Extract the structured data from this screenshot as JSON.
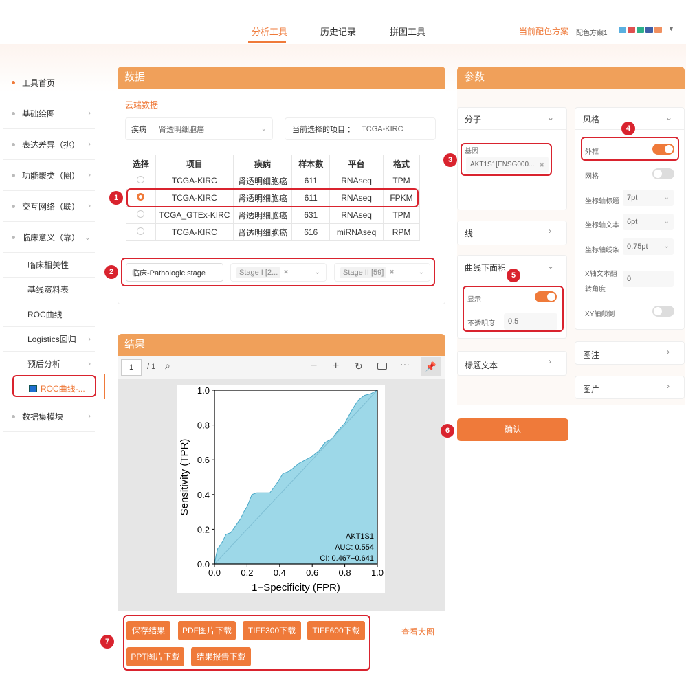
{
  "nav": {
    "tabs": [
      "分析工具",
      "历史记录",
      "拼图工具"
    ],
    "scheme_label": "当前配色方案",
    "scheme_value": "配色方案1",
    "swatch_colors": [
      "#5ab0e0",
      "#e05050",
      "#2db08a",
      "#3f5fa8",
      "#f09060"
    ]
  },
  "sidebar": {
    "items": [
      {
        "label": "工具首页"
      },
      {
        "label": "基础绘图"
      },
      {
        "label": "表达差异（挑）"
      },
      {
        "label": "功能聚类（圈）"
      },
      {
        "label": "交互网络（联）"
      },
      {
        "label": "临床意义（靠）"
      }
    ],
    "subitems": [
      {
        "label": "临床相关性"
      },
      {
        "label": "基线资料表"
      },
      {
        "label": "ROC曲线"
      },
      {
        "label": "Logistics回归"
      },
      {
        "label": "预后分析"
      }
    ],
    "active": "ROC曲线-...",
    "last": "数据集模块"
  },
  "data_panel": {
    "title": "数据",
    "cloud_link": "云端数据",
    "disease_label": "疾病",
    "disease_value": "肾透明细胞癌",
    "project_label": "当前选择的项目 ：",
    "project_value": "TCGA-KIRC",
    "table": {
      "headers": [
        "选择",
        "项目",
        "疾病",
        "样本数",
        "平台",
        "格式"
      ],
      "rows": [
        [
          "TCGA-KIRC",
          "肾透明细胞癌",
          "611",
          "RNAseq",
          "TPM"
        ],
        [
          "TCGA-KIRC",
          "肾透明细胞癌",
          "611",
          "RNAseq",
          "FPKM"
        ],
        [
          "TCGA_GTEx-KIRC",
          "肾透明细胞癌",
          "631",
          "RNAseq",
          "TPM"
        ],
        [
          "TCGA-KIRC",
          "肾透明细胞癌",
          "616",
          "miRNAseq",
          "RPM"
        ]
      ]
    },
    "filter_field": "临床-Pathologic.stage",
    "filter_g1": "Stage I [2...",
    "filter_g2": "Stage II [59]"
  },
  "result_panel": {
    "title": "结果",
    "page": "1",
    "page_total": "/ 1",
    "buttons": [
      "保存结果",
      "PDF图片下载",
      "TIFF300下载",
      "TIFF600下载",
      "PPT图片下载",
      "结果报告下载"
    ],
    "view_large": "查看大图"
  },
  "params": {
    "title": "参数",
    "molecule": "分子",
    "gene_label": "基因",
    "gene_value": "AKT1S1[ENSG000...",
    "line": "线",
    "auc_area": "曲线下面积",
    "show": "显示",
    "opacity_label": "不透明度",
    "opacity_value": "0.5",
    "title_text": "标题文本",
    "confirm": "确认",
    "style": "风格",
    "frame": "外框",
    "grid": "网格",
    "axis_title": "坐标轴标题",
    "axis_title_v": "7pt",
    "axis_text": "坐标轴文本",
    "axis_text_v": "6pt",
    "axis_line": "坐标轴线条",
    "axis_line_v": "0.75pt",
    "x_rot_1": "X轴文本翻",
    "x_rot_2": "转角度",
    "x_rot_v": "0",
    "xy_flip": "XY轴颠倒",
    "legend": "图注",
    "image": "图片"
  },
  "annotations": [
    "1",
    "2",
    "3",
    "4",
    "5",
    "6",
    "7"
  ],
  "chart_data": {
    "type": "area",
    "title": "",
    "xlabel": "1−Specificity (FPR)",
    "ylabel": "Sensitivity (TPR)",
    "xlim": [
      0,
      1
    ],
    "ylim": [
      0,
      1
    ],
    "ticks": [
      "0.0",
      "0.2",
      "0.4",
      "0.6",
      "0.8",
      "1.0"
    ],
    "annot": [
      "AKT1S1",
      "AUC: 0.554",
      "CI: 0.467−0.641"
    ],
    "fill": "#9dd8e8",
    "x": [
      0,
      0.01,
      0.02,
      0.03,
      0.05,
      0.07,
      0.1,
      0.13,
      0.16,
      0.18,
      0.2,
      0.23,
      0.26,
      0.3,
      0.34,
      0.38,
      0.42,
      0.45,
      0.48,
      0.52,
      0.56,
      0.6,
      0.64,
      0.68,
      0.72,
      0.76,
      0.8,
      0.84,
      0.88,
      0.92,
      0.96,
      1.0
    ],
    "y": [
      0,
      0.05,
      0.09,
      0.1,
      0.13,
      0.17,
      0.18,
      0.22,
      0.26,
      0.3,
      0.33,
      0.4,
      0.41,
      0.41,
      0.41,
      0.46,
      0.52,
      0.53,
      0.55,
      0.58,
      0.6,
      0.62,
      0.65,
      0.7,
      0.72,
      0.77,
      0.81,
      0.88,
      0.94,
      0.97,
      0.98,
      1.0
    ]
  }
}
